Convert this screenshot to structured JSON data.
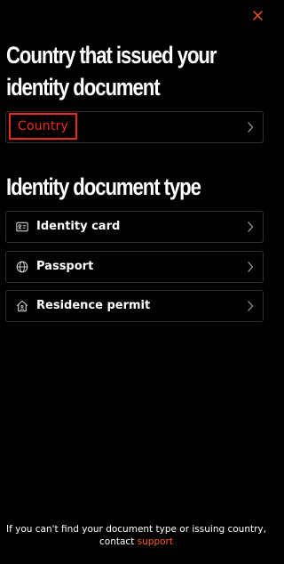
{
  "colors": {
    "background": "#000000",
    "accent": "#ff5a1f",
    "highlight_border": "#e8291c",
    "row_border": "#2e2e2e"
  },
  "header": {
    "close_icon": "close-icon"
  },
  "country_section": {
    "heading_line1": "Country that issued your",
    "heading_line2": "identity document",
    "selector_label": "Country"
  },
  "doc_type_section": {
    "heading": "Identity document type",
    "options": [
      {
        "label": "Identity card",
        "icon": "id-card-icon"
      },
      {
        "label": "Passport",
        "icon": "globe-icon"
      },
      {
        "label": "Residence permit",
        "icon": "home-icon"
      }
    ]
  },
  "footer": {
    "text_line1": "If you can't find your document type or issuing country,",
    "text_line2_prefix": "contact",
    "link_label": "support"
  }
}
